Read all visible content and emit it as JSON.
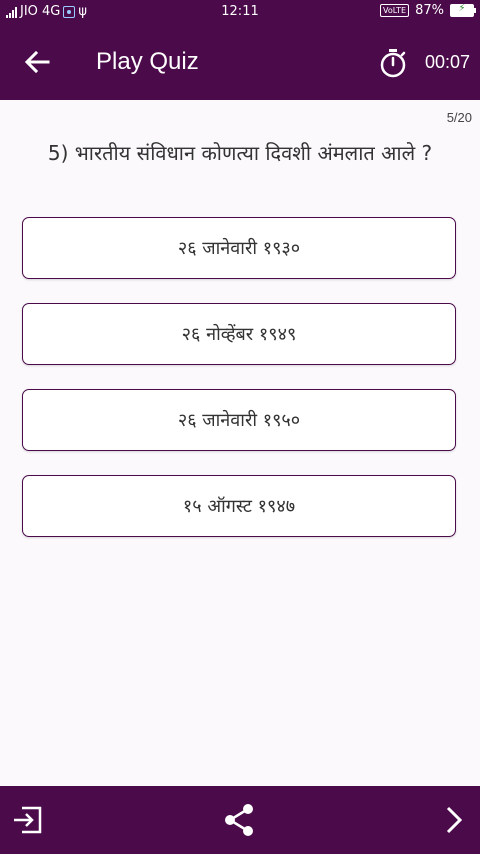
{
  "status_bar": {
    "carrier": "JIO 4G",
    "time": "12:11",
    "volte": "VoLTE",
    "battery": "87%"
  },
  "app_bar": {
    "title": "Play Quiz",
    "timer": "00:07",
    "icons": [
      "arrow-left-icon",
      "stopwatch-icon"
    ]
  },
  "quiz": {
    "progress": "5/20",
    "question": "5) भारतीय संविधान कोणत्या दिवशी अंमलात आले ?",
    "options": [
      "२६ जानेवारी १९३०",
      "२६ नोव्हेंबर १९४९",
      "२६ जानेवारी १९५०",
      "१५ ऑगस्ट १९४७"
    ]
  },
  "bottom_bar": {
    "icons": [
      "exit-icon",
      "share-icon",
      "chevron-right-icon"
    ]
  },
  "colors": {
    "primary": "#4b0a4a",
    "background": "#fbf9fb",
    "text": "#333333"
  }
}
